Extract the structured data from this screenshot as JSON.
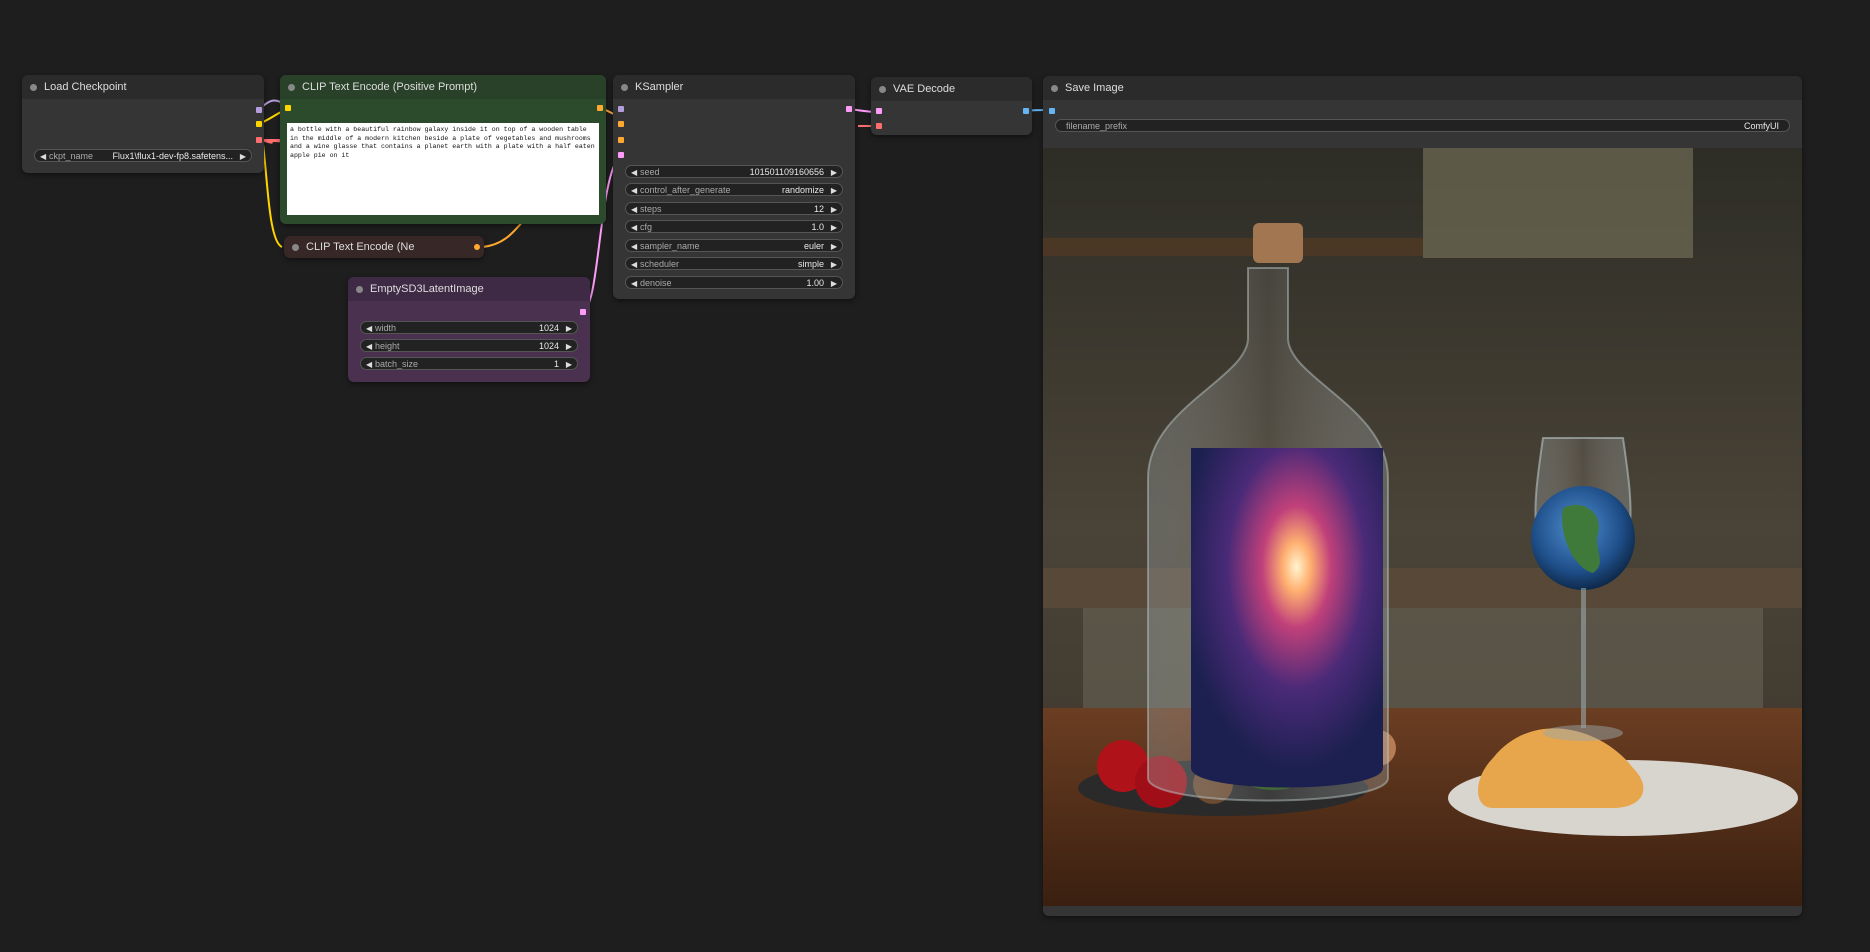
{
  "nodes": {
    "load_checkpoint": {
      "title": "Load Checkpoint",
      "widget_label": "ckpt_name",
      "widget_value": "Flux1\\flux1-dev-fp8.safetens..."
    },
    "clip_pos": {
      "title": "CLIP Text Encode (Positive Prompt)",
      "prompt": "a bottle with a beautiful rainbow galaxy inside it on top of a wooden table in the middle of a modern kitchen beside a plate of vegetables and mushrooms and a wine glasse that contains a planet earth with a plate with a half eaten apple pie on it"
    },
    "clip_neg": {
      "title": "CLIP Text Encode (Ne"
    },
    "empty_latent": {
      "title": "EmptySD3LatentImage",
      "widgets": [
        {
          "label": "width",
          "value": "1024"
        },
        {
          "label": "height",
          "value": "1024"
        },
        {
          "label": "batch_size",
          "value": "1"
        }
      ]
    },
    "ksampler": {
      "title": "KSampler",
      "widgets": [
        {
          "label": "seed",
          "value": "101501109160656"
        },
        {
          "label": "control_after_generate",
          "value": "randomize"
        },
        {
          "label": "steps",
          "value": "12"
        },
        {
          "label": "cfg",
          "value": "1.0"
        },
        {
          "label": "sampler_name",
          "value": "euler"
        },
        {
          "label": "scheduler",
          "value": "simple"
        },
        {
          "label": "denoise",
          "value": "1.00"
        }
      ]
    },
    "vae_decode": {
      "title": "VAE Decode"
    },
    "save_image": {
      "title": "Save Image",
      "widget_label": "filename_prefix",
      "widget_value": "ComfyUI"
    }
  },
  "icons": {
    "arrow_left": "◀",
    "arrow_right": "▶"
  },
  "colors": {
    "canvas": "#1e1e1e",
    "node_body": "#353535",
    "node_title": "#2b2b2b",
    "clip_green": "#2c4a2c",
    "latent_purple": "#4a3150",
    "neg_brown": "#372727",
    "model_link": "#b39ddb",
    "clip_link": "#ffd500",
    "vae_link": "#ff6e6e",
    "conditioning_link": "#ffa931",
    "latent_link": "#ff9cf9",
    "image_link": "#64b5f6"
  }
}
